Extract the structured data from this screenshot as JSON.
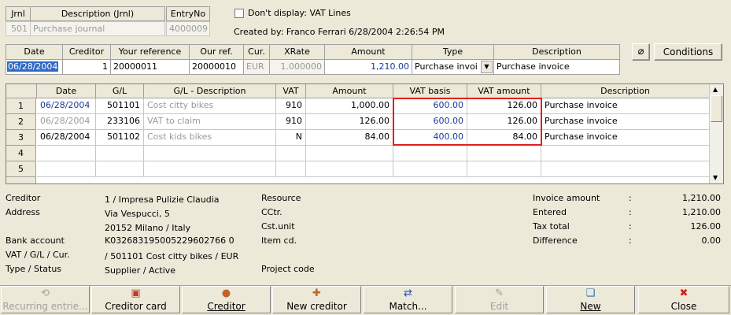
{
  "journal": {
    "headers": [
      "Jrnl",
      "Description (Jrnl)",
      "EntryNo"
    ],
    "jrnl": "501",
    "description": "Purchase journal",
    "entry_no": "4000009"
  },
  "options": {
    "dont_display_label": "Don't display: VAT Lines",
    "created_by": "Created by: Franco Ferrari  6/28/2004 2:26:54 PM"
  },
  "entry": {
    "headers": [
      "Date",
      "Creditor",
      "Your reference",
      "Our ref.",
      "Cur.",
      "XRate",
      "Amount",
      "Type",
      "Description"
    ],
    "date": "06/28/2004",
    "creditor": "1",
    "your_reference": "20000011",
    "our_ref": "20000010",
    "currency": "EUR",
    "xrate": "1.000000",
    "amount": "1,210.00",
    "type": "Purchase invoi",
    "description": "Purchase invoice"
  },
  "buttons": {
    "attach_icon": "paperclip-icon",
    "conditions": "Conditions"
  },
  "lines": {
    "headers": [
      "Date",
      "G/L",
      "G/L - Description",
      "VAT",
      "Amount",
      "VAT basis",
      "VAT amount",
      "Description"
    ],
    "rows": [
      {
        "n": "1",
        "date": "06/28/2004",
        "gl": "501101",
        "gl_desc": "Cost citty bikes",
        "vat": "910",
        "amount": "1,000.00",
        "vat_basis": "600.00",
        "vat_amount": "126.00",
        "desc": "Purchase invoice"
      },
      {
        "n": "2",
        "date": "06/28/2004",
        "gl": "233106",
        "gl_desc": "VAT to claim",
        "vat": "910",
        "amount": "126.00",
        "vat_basis": "600.00",
        "vat_amount": "126.00",
        "desc": "Purchase invoice"
      },
      {
        "n": "3",
        "date": "06/28/2004",
        "gl": "501102",
        "gl_desc": "Cost kids bikes",
        "vat": "N",
        "amount": "84.00",
        "vat_basis": "400.00",
        "vat_amount": "84.00",
        "desc": "Purchase invoice"
      },
      {
        "n": "4"
      },
      {
        "n": "5"
      }
    ]
  },
  "info": {
    "creditor_label": "Creditor",
    "creditor_value": "1 / Impresa Pulizie Claudia",
    "address_label": "Address",
    "address_line1": "Via Vespucci, 5",
    "address_line2": "20152 Milano / Italy",
    "bank_label": "Bank account",
    "bank_value": "K032683195005229602766 0",
    "vat_label": "VAT / G/L / Cur.",
    "vat_value": " / 501101 Cost citty bikes / EUR",
    "type_label": "Type / Status",
    "type_value": "Supplier / Active",
    "resource_label": "Resource",
    "cctr_label": "CCtr.",
    "cstunit_label": "Cst.unit",
    "itemcd_label": "Item cd.",
    "project_label": "Project code"
  },
  "totals": {
    "invoice_label": "Invoice amount",
    "invoice_value": "1,210.00",
    "entered_label": "Entered",
    "entered_value": "1,210.00",
    "tax_label": "Tax total",
    "tax_value": "126.00",
    "diff_label": "Difference",
    "diff_value": "0.00",
    "sep": ":"
  },
  "toolbar": {
    "recurring": "Recurring entrie...",
    "creditor_card": "Creditor card",
    "creditor": "Creditor",
    "new_creditor": "New creditor",
    "match": "Match...",
    "edit": "Edit",
    "new": "New",
    "close": "Close"
  },
  "colors": {
    "highlight_border": "#e0201c",
    "value_blue": "#1a3a9a"
  }
}
